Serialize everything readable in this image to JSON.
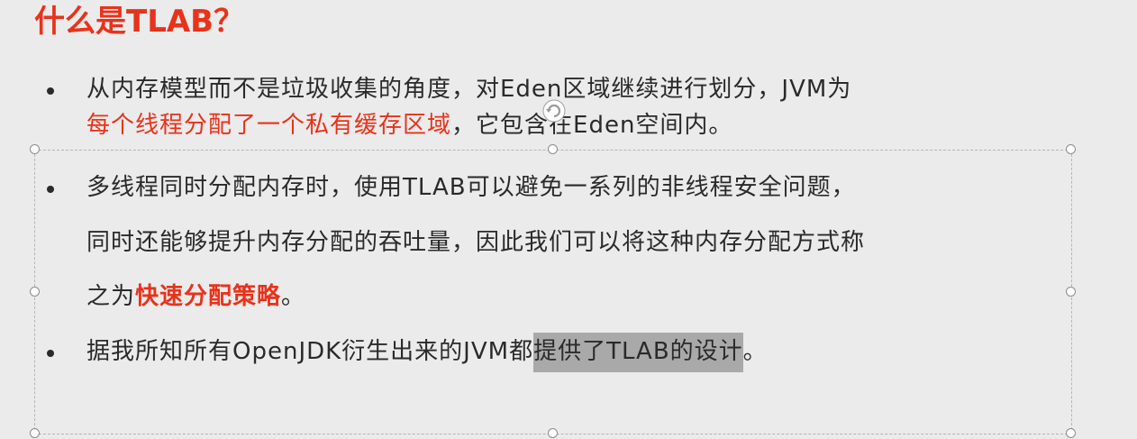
{
  "slide": {
    "title": "什么是TLAB？",
    "bullets": [
      {
        "lines": [
          {
            "segments": [
              {
                "text": "从内存模型而不是垃圾收集的角度，对Eden区域继续进行划分，JVM为",
                "style": "normal"
              }
            ]
          },
          {
            "segments": [
              {
                "text": "每个线程分配了一个私有缓存区域",
                "style": "red"
              },
              {
                "text": "，它包含在Eden空间内。",
                "style": "normal"
              }
            ]
          }
        ]
      },
      {
        "lines": [
          {
            "segments": [
              {
                "text": "多线程同时分配内存时，使用TLAB可以避免一系列的非线程安全问题，",
                "style": "normal"
              }
            ]
          },
          {
            "segments": [
              {
                "text": "同时还能够提升内存分配的吞吐量，因此我们可以将这种内存分配方式称",
                "style": "normal"
              }
            ]
          },
          {
            "segments": [
              {
                "text": "之为",
                "style": "normal"
              },
              {
                "text": "快速分配策略",
                "style": "red-bold"
              },
              {
                "text": "。",
                "style": "normal"
              }
            ]
          }
        ]
      },
      {
        "lines": [
          {
            "segments": [
              {
                "text": "据我所知所有OpenJDK衍生出来的JVM都",
                "style": "normal"
              },
              {
                "text": "提供了TLAB的设计",
                "style": "highlight"
              },
              {
                "text": "。",
                "style": "normal"
              }
            ]
          }
        ]
      }
    ]
  },
  "colors": {
    "accent_red": "#e8321a",
    "body_text": "#2a2a2a",
    "selection_highlight": "#a9a9a9",
    "background": "#ebebeb"
  },
  "icons": {
    "rotate_handle": "rotate-handle-icon"
  }
}
